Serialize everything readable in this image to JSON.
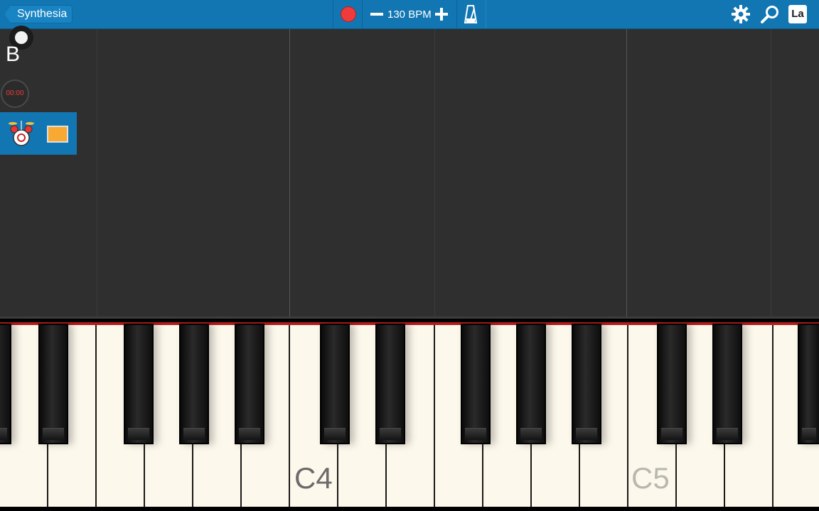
{
  "toolbar": {
    "back_label": "Synthesia",
    "tempo_value": "130 BPM",
    "labels_button": "La",
    "icons": [
      "record-icon",
      "minus-icon",
      "plus-icon",
      "metronome-icon",
      "gear-icon",
      "magnifier-icon",
      "labels-icon"
    ],
    "accent": "#1276b3",
    "record_color": "#ef3b3b"
  },
  "sidebar": {
    "hand_label": "B",
    "timer": "00:00",
    "track_swatch_color": "#f7a931"
  },
  "keyboard": {
    "labels": [
      "C4",
      "C5"
    ]
  }
}
